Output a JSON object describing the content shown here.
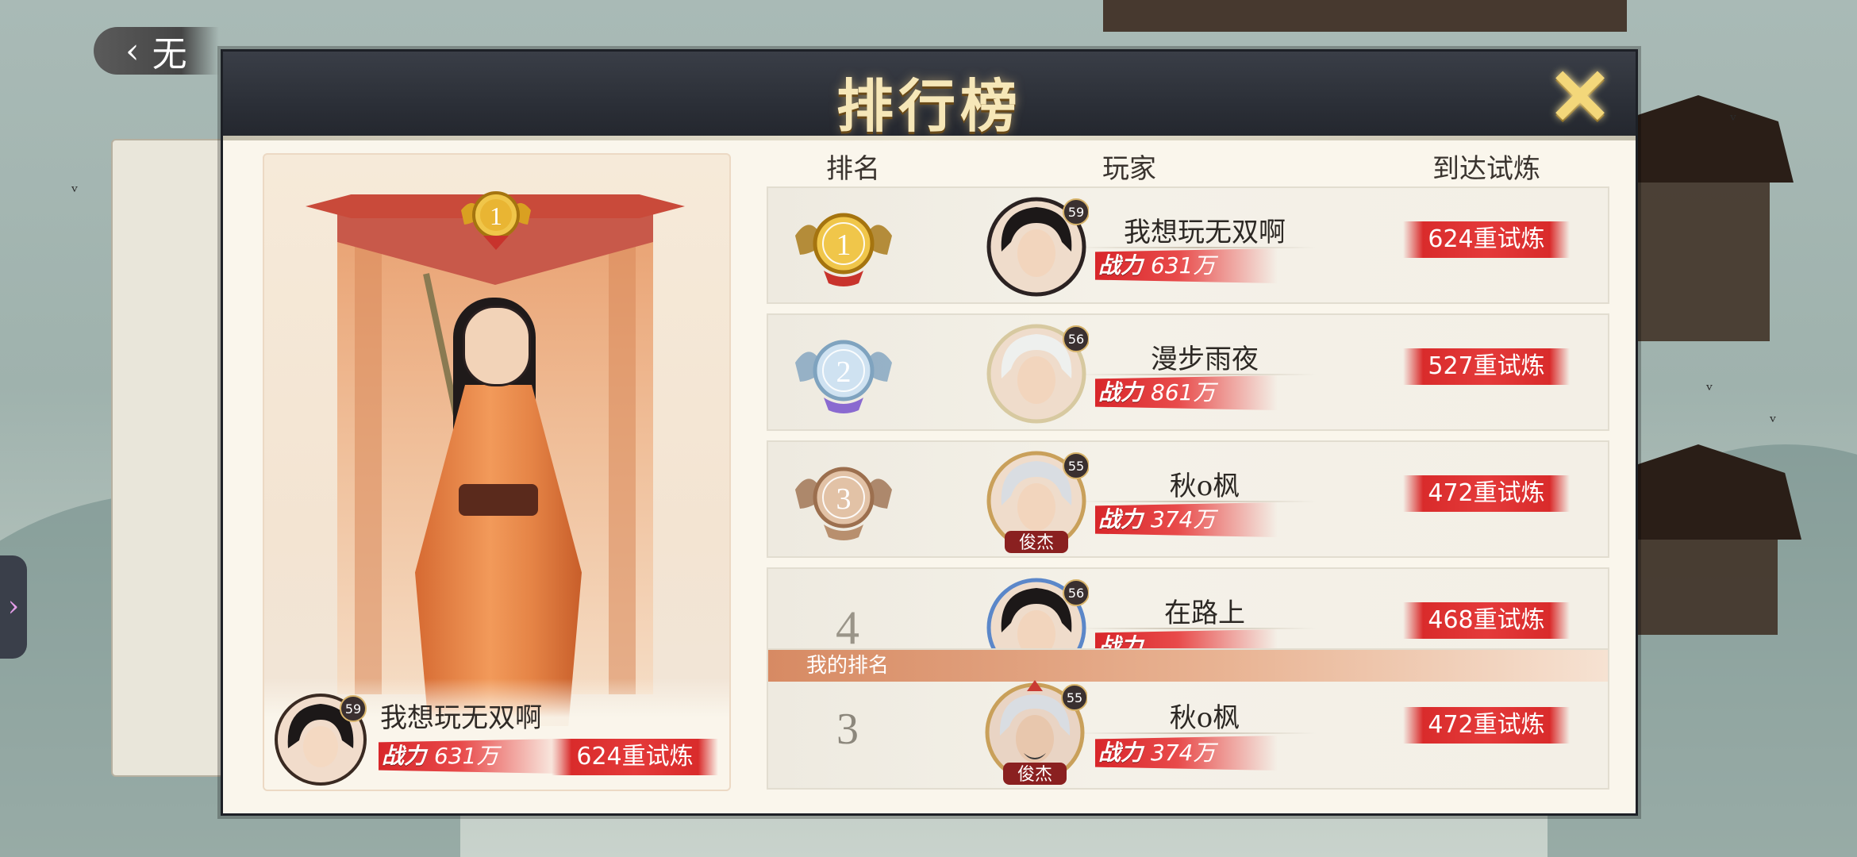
{
  "background": {
    "back_label": "无"
  },
  "modal": {
    "title": "排行榜",
    "close_icon": "close-x-icon"
  },
  "columns": {
    "rank": "排名",
    "player": "玩家",
    "trial": "到达试炼"
  },
  "champion": {
    "rank": "1",
    "level": "59",
    "name": "我想玩无双啊",
    "power_label": "战力",
    "power": "631万",
    "trial": "624重试炼"
  },
  "rows": [
    {
      "rank": "1",
      "medal": "gold",
      "level": "59",
      "name": "我想玩无双啊",
      "power_label": "战力",
      "power": "631万",
      "trial": "624重试炼",
      "avatar_style": "black-hair"
    },
    {
      "rank": "2",
      "medal": "silver",
      "level": "56",
      "name": "漫步雨夜",
      "power_label": "战力",
      "power": "861万",
      "trial": "527重试炼",
      "avatar_style": "white-hair"
    },
    {
      "rank": "3",
      "medal": "bronze",
      "level": "55",
      "name": "秋o枫",
      "power_label": "战力",
      "power": "374万",
      "trial": "472重试炼",
      "avatar_style": "grey-hair",
      "avatar_caption": "俊杰"
    },
    {
      "rank": "4",
      "medal": "none",
      "level": "56",
      "name": "在路上",
      "power_label": "战力",
      "power": "",
      "trial": "468重试炼",
      "avatar_style": "blue-crown"
    }
  ],
  "my_rank": {
    "label": "我的排名",
    "rank": "3",
    "level": "55",
    "name": "秋o枫",
    "power_label": "战力",
    "power": "374万",
    "trial": "472重试炼",
    "avatar_caption": "俊杰"
  },
  "colors": {
    "gold": "#e2b13a",
    "silver": "#a8c4da",
    "bronze": "#caa07f",
    "accent_red": "#d92b2b",
    "title_gold": "#f6e7b8"
  }
}
